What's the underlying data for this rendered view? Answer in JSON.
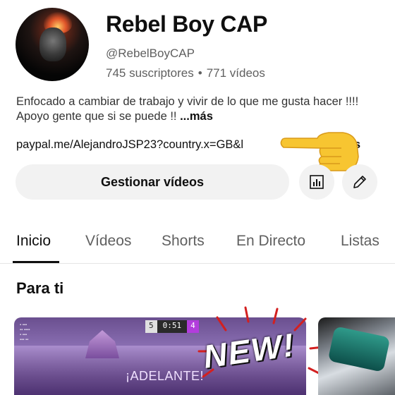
{
  "channel": {
    "name": "Rebel Boy CAP",
    "handle": "@RebelBoyCAP",
    "subscribers": "745 suscriptores",
    "separator": "•",
    "videos_count": "771 vídeos",
    "description": "Enfocado a cambiar de trabajo y vivir de lo que me gusta hacer !!!! Apoyo gente que si se puede !! ",
    "description_more": "...más",
    "link": "paypal.me/AlejandroJSP23?country.x=GB&l",
    "link_more": "más"
  },
  "actions": {
    "manage_label": "Gestionar vídeos",
    "stats_icon": "bar-chart-icon",
    "edit_icon": "pencil-icon"
  },
  "tabs": [
    {
      "label": "Inicio",
      "active": true
    },
    {
      "label": "Vídeos",
      "active": false
    },
    {
      "label": "Shorts",
      "active": false
    },
    {
      "label": "En Directo",
      "active": false
    },
    {
      "label": "Listas",
      "active": false
    }
  ],
  "section": {
    "title": "Para ti"
  },
  "thumbnail1": {
    "score_left": "5",
    "time": "0:51",
    "score_right": "4",
    "overlay_text": "¡ADELANTE!",
    "badge": "NEW!"
  },
  "colors": {
    "accent": "#0f0f0f",
    "secondary_text": "#606060",
    "button_bg": "#f2f2f2"
  }
}
